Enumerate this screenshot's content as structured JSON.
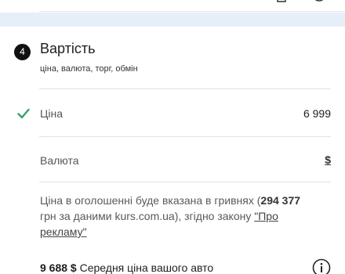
{
  "section": {
    "step_number": "4",
    "title": "Вартість",
    "subtitle": "ціна, валюта, торг, обмін"
  },
  "price": {
    "label": "Ціна",
    "value": "6 999",
    "status": "checked"
  },
  "currency": {
    "label": "Валюта",
    "value": "$"
  },
  "notice": {
    "part1": "Ціна в оголошенні буде вказана в гривнях (",
    "uah_amount": "294 377",
    "part2": " грн за даними kurs.com.ua), згідно закону ",
    "law_link": "\"Про рекламу\""
  },
  "average": {
    "amount": "9 688 $",
    "label": " Середня ціна вашого авто"
  },
  "colors": {
    "check_green": "#33a36b",
    "band_blue": "#e6eef8",
    "badge_black": "#111111"
  }
}
